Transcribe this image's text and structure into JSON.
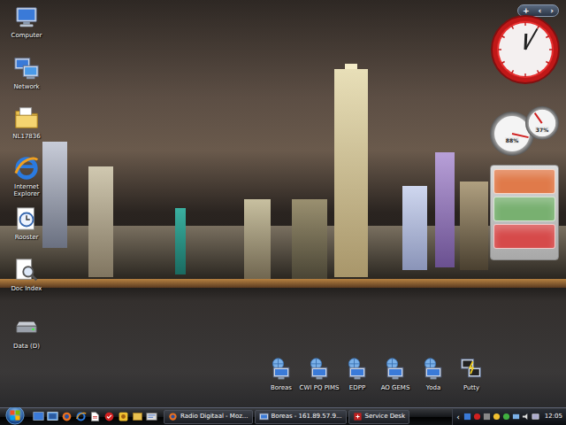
{
  "desktop_icons": [
    {
      "label": "Computer"
    },
    {
      "label": "Network"
    },
    {
      "label": "NL17836"
    },
    {
      "label": "Internet Explorer"
    },
    {
      "label": "Rooster"
    },
    {
      "label": "Doc Index"
    },
    {
      "label": "Data (D)"
    }
  ],
  "shortcuts": [
    {
      "label": "Boreas"
    },
    {
      "label": "CWI PQ PIMS"
    },
    {
      "label": "EDPP"
    },
    {
      "label": "AO GEMS"
    },
    {
      "label": "Yoda"
    },
    {
      "label": "Putty"
    }
  ],
  "sidebar": {
    "controls": [
      "+",
      "‹",
      "›"
    ],
    "clock": {
      "hour_level": 0.007,
      "minute_level": 0.083
    },
    "meters": [
      {
        "reading": "88%",
        "level": 0.88
      },
      {
        "reading": "37%",
        "level": 0.37
      }
    ],
    "notes": [
      {
        "color": "#e07a4a"
      },
      {
        "color": "#78b070"
      },
      {
        "color": "#d64a4a"
      }
    ]
  },
  "taskbar": {
    "tasks": [
      {
        "label": "Radio Digitaal - Moz...",
        "selected": false
      },
      {
        "label": "Boreas - 161.89.57.9...",
        "selected": false
      },
      {
        "label": "Service Desk",
        "selected": false
      }
    ],
    "tray": {
      "expand": "‹",
      "clock": "12:05"
    }
  }
}
